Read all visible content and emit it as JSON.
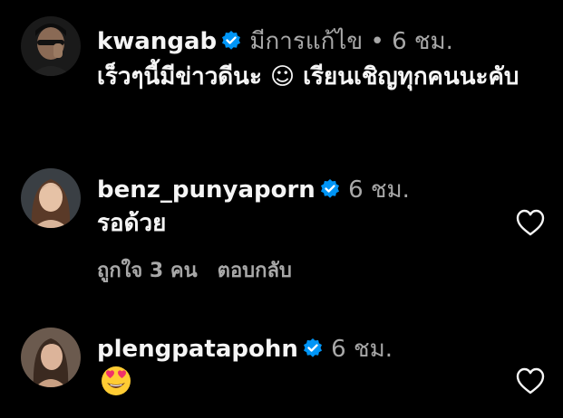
{
  "comments": [
    {
      "username": "kwangab",
      "edited": "มีการแก้ไข",
      "separator": "•",
      "time": "6 ชม.",
      "text": "เร็วๆนี้มีข่าวดีนะ ☺ เรียนเชิญทุกคนนะคับ"
    },
    {
      "username": "benz_punyaporn",
      "time": "6 ชม.",
      "text": "รอด้วย",
      "likes": "ถูกใจ 3 คน",
      "reply": "ตอบกลับ"
    },
    {
      "username": "plengpatapohn",
      "time": "6 ชม.",
      "text": "😍"
    }
  ],
  "colors": {
    "background": "#000000",
    "text_primary": "#f5f5f5",
    "text_secondary": "#a8a8a8",
    "verified_blue": "#0095f6"
  },
  "icons": {
    "verified": "verified-badge-icon",
    "like": "heart-outline-icon",
    "emoji": "heart-eyes-emoji"
  }
}
